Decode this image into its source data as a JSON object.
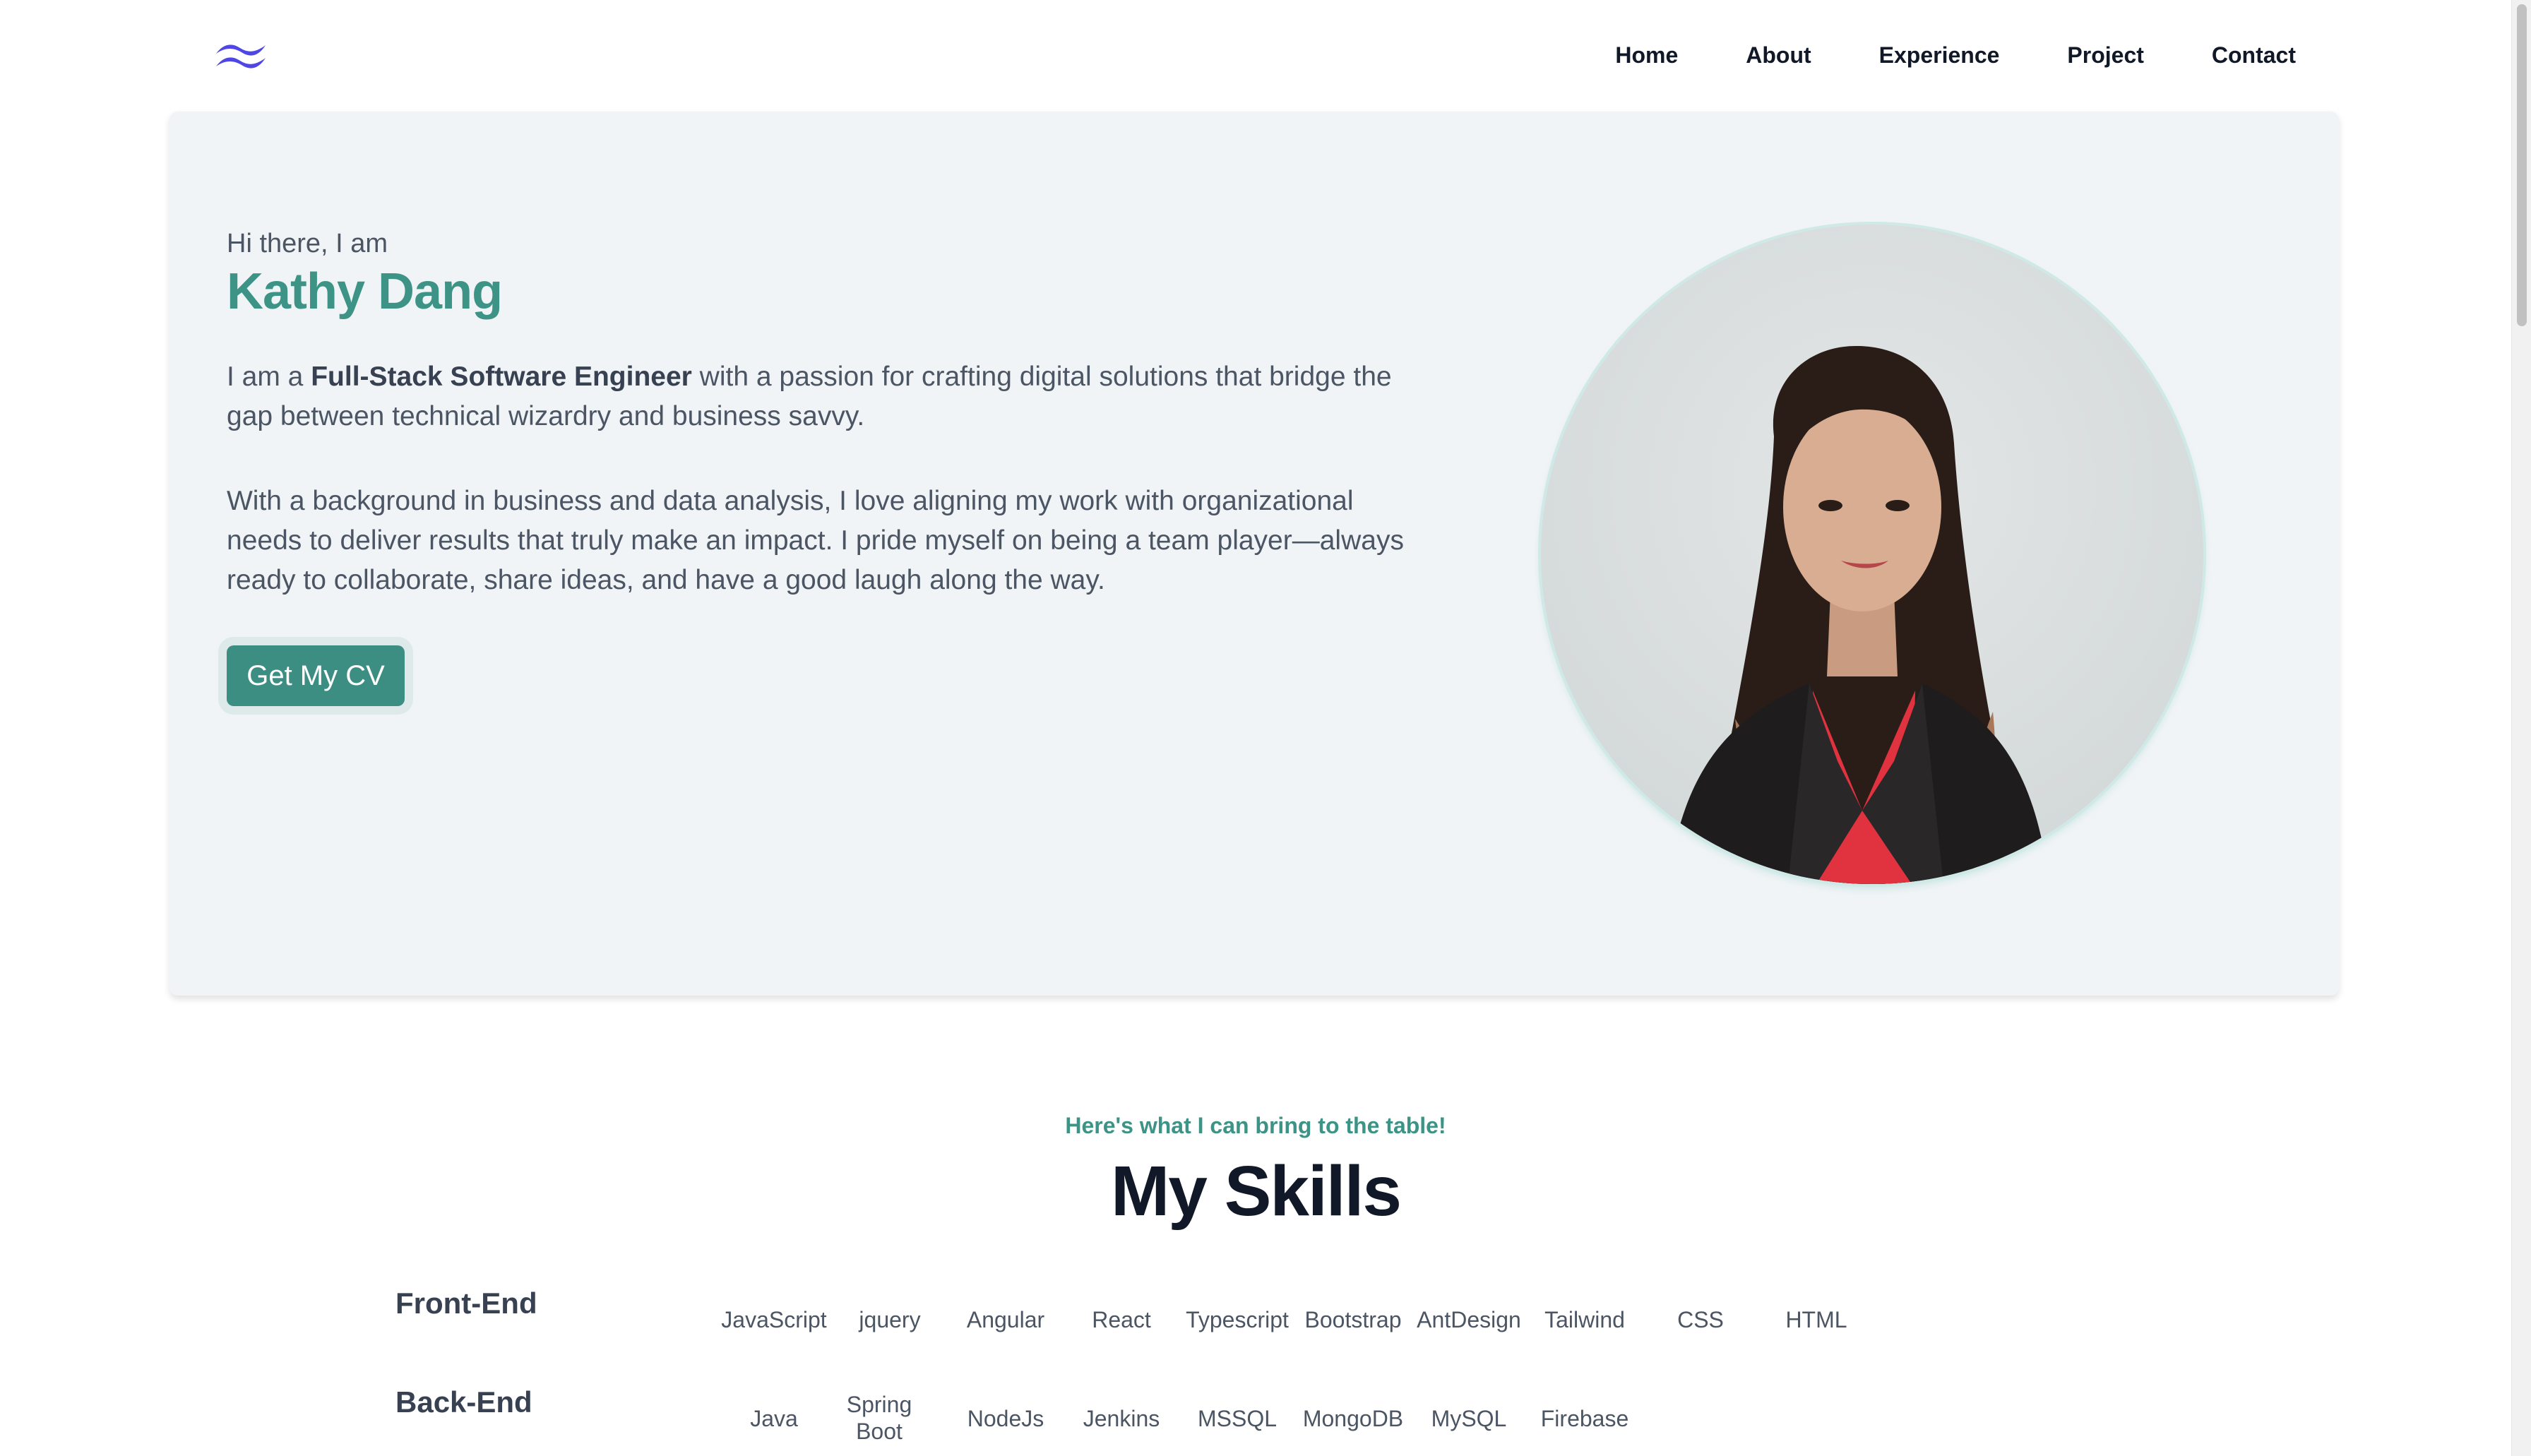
{
  "nav": {
    "logo_icon": "wave-logo-icon",
    "items": [
      "Home",
      "About",
      "Experience",
      "Project",
      "Contact"
    ]
  },
  "hero": {
    "greeting": "Hi there, I am",
    "name": "Kathy Dang",
    "intro_before": "I am a ",
    "intro_bold": "Full-Stack Software Engineer",
    "intro_after": " with a passion for crafting digital solutions that bridge the gap between technical wizardry and business savvy.",
    "paragraph2": "With a background in business and data analysis, I love aligning my work with organizational needs to deliver results that truly make an impact. I pride myself on being a team player—always ready to collaborate, share ideas, and have a good laugh along the way.",
    "cv_button": "Get My CV"
  },
  "skills": {
    "subtitle": "Here's what I can bring to the table!",
    "title": "My Skills",
    "categories": [
      {
        "label": "Front-End",
        "items": [
          "JavaScript",
          "jquery",
          "Angular",
          "React",
          "Typescript",
          "Bootstrap",
          "AntDesign",
          "Tailwind",
          "CSS",
          "HTML"
        ]
      },
      {
        "label": "Back-End",
        "items": [
          "Java",
          "Spring Boot",
          "NodeJs",
          "Jenkins",
          "MSSQL",
          "MongoDB",
          "MySQL",
          "Firebase"
        ]
      }
    ]
  },
  "colors": {
    "accent": "#3c9386",
    "button": "#3c8e83",
    "hero_bg": "#f1f4f7",
    "logo": "#4f46e5"
  }
}
